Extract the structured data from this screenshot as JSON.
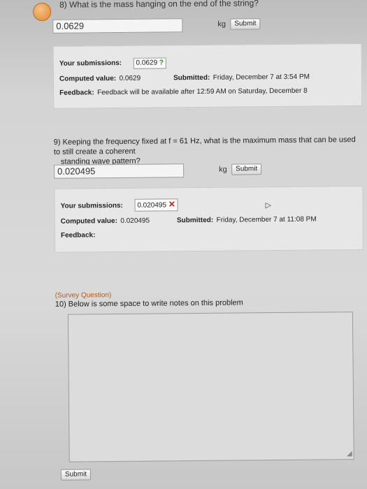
{
  "q8": {
    "title": "8) What is the mass hanging on the end of the string?",
    "answer_value": "0.0629",
    "unit": "kg",
    "submit_label": "Submit",
    "submissions_label": "Your submissions:",
    "submitted_answer": "0.0629",
    "computed_label": "Computed value:",
    "computed_value": "0.0629",
    "submitted_label": "Submitted:",
    "submitted_time": "Friday, December 7 at 3:54 PM",
    "feedback_label": "Feedback:",
    "feedback_text": "Feedback will be available after 12:59 AM on Saturday, December 8"
  },
  "q9": {
    "question_line1": "9) Keeping the frequency fixed at f = 61 Hz, what is the maximum mass that can be used to still create a coherent",
    "question_line2": "standing wave pattern?",
    "answer_value": "0.020495",
    "unit": "kg",
    "submit_label": "Submit",
    "submissions_label": "Your submissions:",
    "submitted_answer": "0.020495",
    "computed_label": "Computed value:",
    "computed_value": "0.020495",
    "submitted_label": "Submitted:",
    "submitted_time": "Friday, December 7 at 11:08 PM",
    "feedback_label": "Feedback:"
  },
  "q10": {
    "survey_label": "(Survey Question)",
    "question": "10) Below is some space to write notes on this problem",
    "submit_label": "Submit"
  },
  "icons": {
    "check": "?",
    "cross": "✕",
    "grip": "◢"
  },
  "colors": {
    "check_green": "#3c7a2e",
    "cross_red": "#c0221b",
    "survey_orange": "#b05a1a"
  }
}
